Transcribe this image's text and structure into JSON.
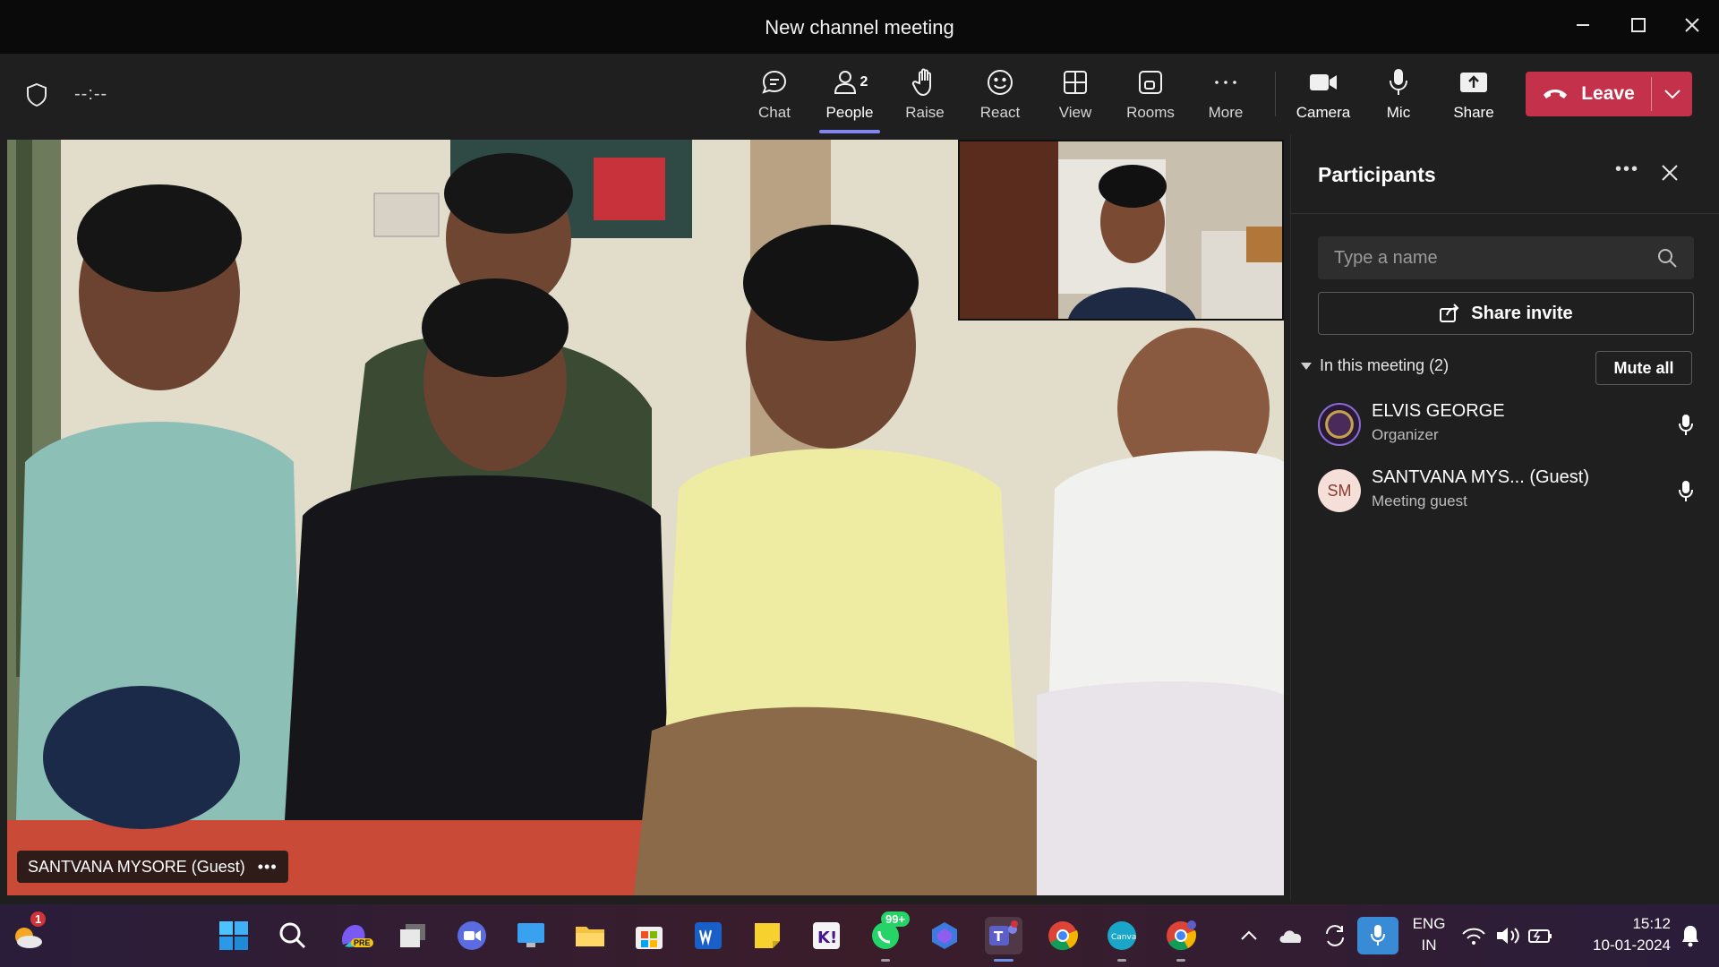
{
  "window": {
    "title": "New channel meeting"
  },
  "toolbar": {
    "timer": "--:--",
    "buttons": {
      "chat": "Chat",
      "people": "People",
      "people_count": "2",
      "raise": "Raise",
      "react": "React",
      "view": "View",
      "rooms": "Rooms",
      "more": "More",
      "camera": "Camera",
      "mic": "Mic",
      "share": "Share"
    },
    "leave_label": "Leave"
  },
  "stage": {
    "speaker_name": "SANTVANA MYSORE (Guest)",
    "speaker_more": "•••"
  },
  "panel": {
    "title": "Participants",
    "more": "•••",
    "search_placeholder": "Type a name",
    "share_invite": "Share invite",
    "section_label": "In this meeting (2)",
    "mute_all": "Mute all",
    "participants": [
      {
        "name": "ELVIS GEORGE",
        "role": "Organizer",
        "initials": ""
      },
      {
        "name": "SANTVANA MYS... (Guest)",
        "role": "Meeting guest",
        "initials": "SM"
      }
    ]
  },
  "taskbar": {
    "weather_badge": "1",
    "whatsapp_badge": "99+",
    "lang_line1": "ENG",
    "lang_line2": "IN",
    "time": "15:12",
    "date": "10-01-2024",
    "copilot_badge": "PRE"
  },
  "colors": {
    "accent": "#7f85f5",
    "leave": "#c4314b",
    "panel_bg": "#1f1f1f",
    "titlebar_bg": "#0a0a0a"
  }
}
